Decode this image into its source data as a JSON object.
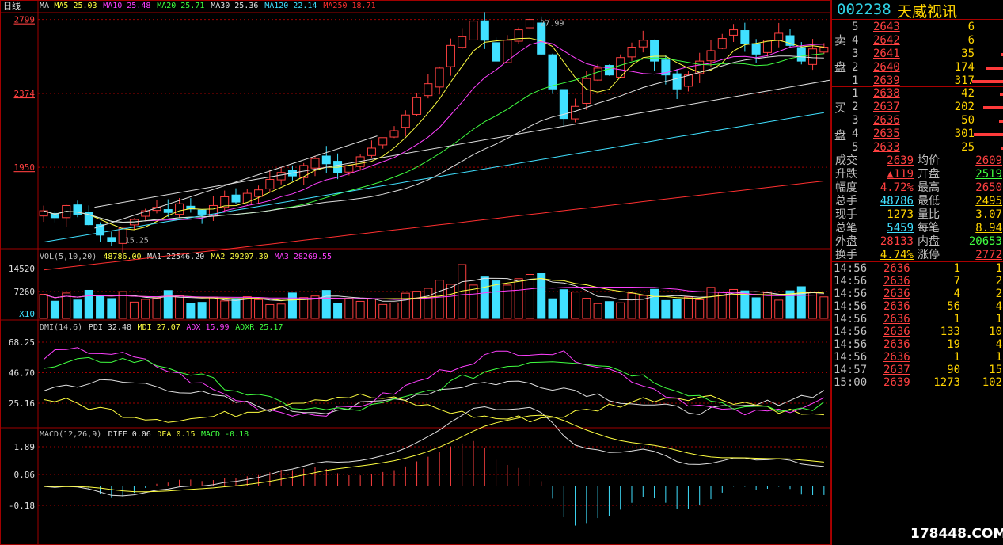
{
  "period_label": "日线",
  "main_legend": [
    {
      "text": "MA",
      "color": "#e0e0e0"
    },
    {
      "text": "MA5 25.03",
      "color": "#ffff40"
    },
    {
      "text": "MA10 25.48",
      "color": "#ff40ff"
    },
    {
      "text": "MA20 25.71",
      "color": "#40ff40"
    },
    {
      "text": "MA30 25.36",
      "color": "#e0e0e0"
    },
    {
      "text": "MA120 22.14",
      "color": "#40e0ff"
    },
    {
      "text": "MA250 18.71",
      "color": "#ff3030"
    }
  ],
  "vol_legend": [
    {
      "text": "VOL(5,10,20)",
      "color": "#c0c0c0"
    },
    {
      "text": "48786.00",
      "color": "#ffff40"
    },
    {
      "text": "MA1 22546.20",
      "color": "#e0e0e0"
    },
    {
      "text": "MA2 29207.30",
      "color": "#ffff40"
    },
    {
      "text": "MA3 28269.55",
      "color": "#ff40ff"
    }
  ],
  "dmi_legend": [
    {
      "text": "DMI(14,6)",
      "color": "#c0c0c0"
    },
    {
      "text": "PDI 32.48",
      "color": "#e0e0e0"
    },
    {
      "text": "MDI 27.07",
      "color": "#ffff40"
    },
    {
      "text": "ADX 15.99",
      "color": "#ff40ff"
    },
    {
      "text": "ADXR 25.17",
      "color": "#40ff40"
    }
  ],
  "macd_legend": [
    {
      "text": "MACD(12,26,9)",
      "color": "#c0c0c0"
    },
    {
      "text": "DIFF 0.06",
      "color": "#e0e0e0"
    },
    {
      "text": "DEA 0.15",
      "color": "#ffff40"
    },
    {
      "text": "MACD -0.18",
      "color": "#40ff40"
    }
  ],
  "axis_labels": {
    "price": [
      "2799",
      "2374",
      "1950"
    ],
    "volume": [
      "14520",
      "7260",
      "X10"
    ],
    "dmi": [
      "68.25",
      "46.70",
      "25.16"
    ],
    "macd": [
      "1.89",
      "0.86",
      "-0.18"
    ]
  },
  "annotations": {
    "high": "27.99",
    "low": "15.25"
  },
  "chart_data": {
    "type": "candlestick",
    "title": "002238 天威视讯 日线",
    "price_range": [
      15.0,
      28.2
    ],
    "approx_close_path": [
      17.0,
      16.6,
      17.3,
      16.8,
      16.2,
      15.6,
      15.25,
      16.0,
      16.5,
      17.0,
      17.2,
      16.9,
      17.4,
      17.1,
      16.8,
      17.3,
      17.8,
      17.5,
      18.0,
      18.2,
      18.8,
      19.2,
      19.0,
      19.6,
      20.0,
      19.7,
      19.2,
      19.6,
      20.1,
      20.6,
      21.2,
      21.6,
      22.5,
      23.5,
      24.3,
      25.2,
      26.5,
      27.0,
      27.9,
      26.8,
      25.6,
      26.8,
      27.4,
      27.99,
      26.0,
      24.0,
      22.3,
      23.0,
      24.6,
      25.2,
      24.8,
      25.8,
      26.4,
      26.8,
      25.6,
      24.8,
      24.0,
      24.8,
      25.6,
      26.2,
      26.9,
      27.4,
      26.6,
      26.0,
      26.8,
      27.2,
      26.5,
      25.6,
      26.3,
      26.4
    ],
    "moving_averages_last": {
      "MA5": 25.03,
      "MA10": 25.48,
      "MA20": 25.71,
      "MA30": 25.36,
      "MA120": 22.14,
      "MA250": 18.71
    },
    "volume_last": 48786.0,
    "volume_ma": {
      "MA1": 22546.2,
      "MA2": 29207.3,
      "MA3": 28269.55
    },
    "dmi_last": {
      "PDI": 32.48,
      "MDI": 27.07,
      "ADX": 15.99,
      "ADXR": 25.17
    },
    "macd_last": {
      "DIFF": 0.06,
      "DEA": 0.15,
      "MACD": -0.18
    }
  },
  "quote": {
    "code": "002238",
    "name": "天威视讯",
    "sell_label": [
      "卖",
      "盘"
    ],
    "buy_label": [
      "买",
      "盘"
    ],
    "sell": [
      {
        "level": "5",
        "price": "2643",
        "volume": "6",
        "bar": 0.0
      },
      {
        "level": "4",
        "price": "2642",
        "volume": "6",
        "bar": 0.0
      },
      {
        "level": "3",
        "price": "2641",
        "volume": "35",
        "bar": 0.11
      },
      {
        "level": "2",
        "price": "2640",
        "volume": "174",
        "bar": 0.55
      },
      {
        "level": "1",
        "price": "2639",
        "volume": "317",
        "bar": 1.0
      }
    ],
    "buy": [
      {
        "level": "1",
        "price": "2638",
        "volume": "42",
        "bar": 0.13
      },
      {
        "level": "2",
        "price": "2637",
        "volume": "202",
        "bar": 0.64
      },
      {
        "level": "3",
        "price": "2636",
        "volume": "50",
        "bar": 0.16
      },
      {
        "level": "4",
        "price": "2635",
        "volume": "301",
        "bar": 0.95
      },
      {
        "level": "5",
        "price": "2633",
        "volume": "25",
        "bar": 0.08
      }
    ],
    "stats": [
      {
        "l1": "成交",
        "v1": "2639",
        "c1": "#ff4040",
        "l2": "均价",
        "v2": "2609",
        "c2": "#ff4040"
      },
      {
        "l1": "升跌",
        "v1": "▲119",
        "c1": "#ff4040",
        "l2": "开盘",
        "v2": "2519",
        "c2": "#40ff40"
      },
      {
        "l1": "幅度",
        "v1": "4.72%",
        "c1": "#ff4040",
        "l2": "最高",
        "v2": "2650",
        "c2": "#ff4040"
      },
      {
        "l1": "总手",
        "v1": "48786",
        "c1": "#40e0ff",
        "l2": "最低",
        "v2": "2495",
        "c2": "#ffd400"
      },
      {
        "l1": "现手",
        "v1": "1273",
        "c1": "#ffd400",
        "l2": "量比",
        "v2": "3.07",
        "c2": "#ffd400"
      },
      {
        "l1": "总笔",
        "v1": "5459",
        "c1": "#40e0ff",
        "l2": "每笔",
        "v2": "8.94",
        "c2": "#ffd400"
      },
      {
        "l1": "外盘",
        "v1": "28133",
        "c1": "#ff4040",
        "l2": "内盘",
        "v2": "20653",
        "c2": "#40ff40"
      },
      {
        "l1": "换手",
        "v1": "4.74%",
        "c1": "#ffd400",
        "l2": "涨停",
        "v2": "2772",
        "c2": "#ff4040"
      }
    ],
    "ticks": [
      {
        "time": "14:56",
        "price": "2636",
        "vol": "1",
        "n": "1"
      },
      {
        "time": "14:56",
        "price": "2636",
        "vol": "7",
        "n": "2"
      },
      {
        "time": "14:56",
        "price": "2636",
        "vol": "4",
        "n": "2"
      },
      {
        "time": "14:56",
        "price": "2636",
        "vol": "56",
        "n": "4"
      },
      {
        "time": "14:56",
        "price": "2636",
        "vol": "1",
        "n": "1"
      },
      {
        "time": "14:56",
        "price": "2636",
        "vol": "133",
        "n": "10"
      },
      {
        "time": "14:56",
        "price": "2636",
        "vol": "19",
        "n": "4"
      },
      {
        "time": "14:56",
        "price": "2636",
        "vol": "1",
        "n": "1"
      },
      {
        "time": "14:57",
        "price": "2637",
        "vol": "90",
        "n": "15"
      },
      {
        "time": "15:00",
        "price": "2639",
        "vol": "1273",
        "n": "102"
      }
    ]
  },
  "watermark": "178448.COM"
}
